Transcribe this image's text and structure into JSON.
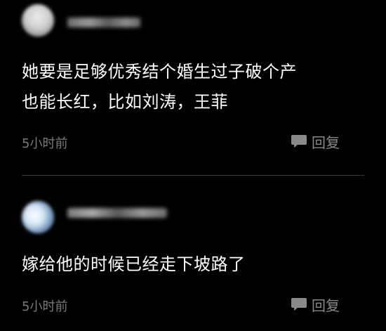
{
  "comments": [
    {
      "text_line1": "她要是足够优秀结个婚生过子破个产",
      "text_line2": "也能长红，比如刘涛，王菲",
      "time": "5小时前",
      "reply_label": "回复"
    },
    {
      "text_line1": "嫁给他的时候已经走下坡路了",
      "time": "5小时前",
      "reply_label": "回复"
    }
  ],
  "colors": {
    "background": "#000000",
    "text": "#ffffff",
    "meta": "#7a7a7a",
    "divider": "#3a3a3a"
  },
  "icons": {
    "reply": "speech-bubble-icon"
  }
}
